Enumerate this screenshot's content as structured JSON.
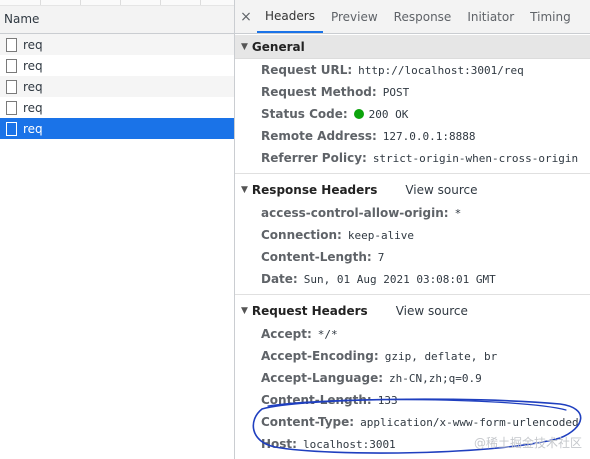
{
  "list": {
    "column_header": "Name",
    "items": [
      {
        "name": "req"
      },
      {
        "name": "req"
      },
      {
        "name": "req"
      },
      {
        "name": "req"
      },
      {
        "name": "req"
      }
    ]
  },
  "tabs": {
    "close_glyph": "×",
    "items": [
      "Headers",
      "Preview",
      "Response",
      "Initiator",
      "Timing"
    ]
  },
  "general": {
    "title": "General",
    "request_url": {
      "k": "Request URL:",
      "v": "http://localhost:3001/req"
    },
    "request_method": {
      "k": "Request Method:",
      "v": "POST"
    },
    "status_code": {
      "k": "Status Code:",
      "v": "200 OK"
    },
    "remote_address": {
      "k": "Remote Address:",
      "v": "127.0.0.1:8888"
    },
    "referrer_policy": {
      "k": "Referrer Policy:",
      "v": "strict-origin-when-cross-origin"
    }
  },
  "response_headers": {
    "title": "Response Headers",
    "view_source": "View source",
    "access_control": {
      "k": "access-control-allow-origin:",
      "v": "*"
    },
    "connection": {
      "k": "Connection:",
      "v": "keep-alive"
    },
    "content_length": {
      "k": "Content-Length:",
      "v": "7"
    },
    "date": {
      "k": "Date:",
      "v": "Sun, 01 Aug 2021 03:08:01 GMT"
    }
  },
  "request_headers": {
    "title": "Request Headers",
    "view_source": "View source",
    "accept": {
      "k": "Accept:",
      "v": "*/*"
    },
    "accept_encoding": {
      "k": "Accept-Encoding:",
      "v": "gzip, deflate, br"
    },
    "accept_language": {
      "k": "Accept-Language:",
      "v": "zh-CN,zh;q=0.9"
    },
    "content_length": {
      "k": "Content-Length:",
      "v": "133"
    },
    "content_type": {
      "k": "Content-Type:",
      "v": "application/x-www-form-urlencoded"
    },
    "host": {
      "k": "Host:",
      "v": "localhost:3001"
    }
  },
  "colors": {
    "accent": "#1a73e8",
    "status_ok": "#0ca40c",
    "annotation_ink": "#1f3fbf"
  },
  "watermark": "@稀土掘金技术社区"
}
